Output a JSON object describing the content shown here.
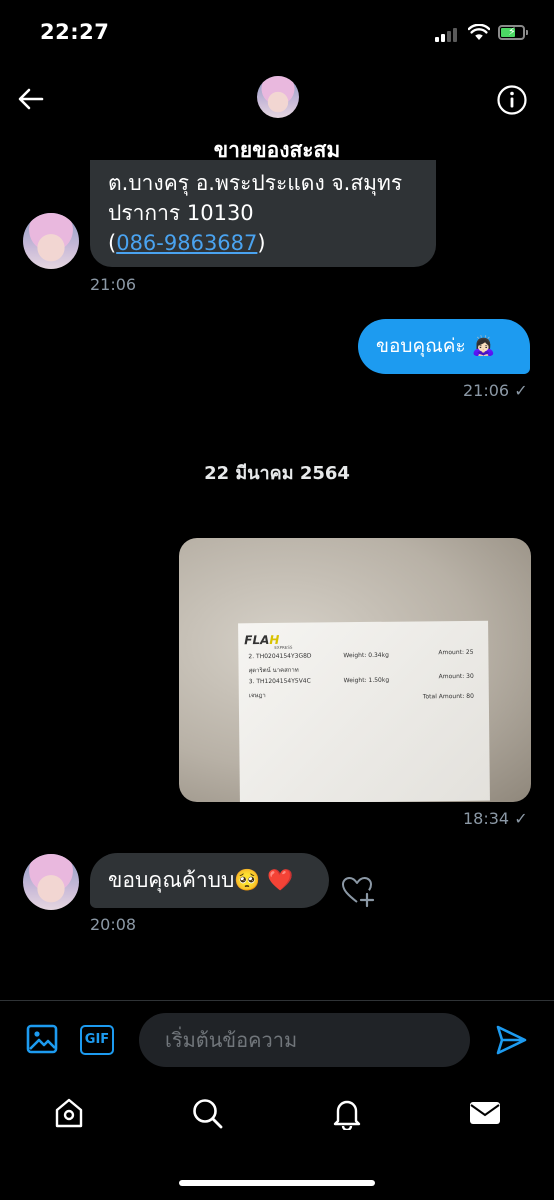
{
  "status_bar": {
    "time": "22:27",
    "battery_icon": "battery-charging-icon",
    "wifi_icon": "wifi-icon",
    "signal_icon": "cellular-signal-icon"
  },
  "header": {
    "title": "ขายของสะสม",
    "back_icon": "arrow-left-icon",
    "info_icon": "info-icon"
  },
  "messages": {
    "m1": {
      "line1": "ต.บางครุ อ.พระประแดง จ.สมุทร",
      "line2": "ปราการ 10130",
      "paren_open": "(",
      "phone": "086-9863687",
      "paren_close": ")",
      "time": "21:06"
    },
    "m2": {
      "text": "ขอบคุณค่ะ 🙇🏻‍♀️",
      "time": "21:06 ✓"
    },
    "date_separator": "22 มีนาคม 2564",
    "m3": {
      "time": "18:34 ✓",
      "photo": {
        "brand": "FLA",
        "brand_accent": "H",
        "brand_sub": "EXPRESS",
        "r1": "2. TH0204154Y3G8D",
        "r1b": "สุดาริตน์ นาคสกาท",
        "w1": "Weight: 0.34kg",
        "a1": "Amount: 25",
        "r2": "3. TH1204154Y5V4C",
        "r2b": "เจษฎา",
        "w2": "Weight: 1.50kg",
        "a2": "Amount: 30",
        "total": "Total Amount: 80"
      }
    },
    "m4": {
      "text": "ขอบคุณค้าบบ🥺 ❤️",
      "time": "20:08",
      "react_icon": "heart-add-icon"
    }
  },
  "composer": {
    "placeholder": "เริ่มต้นข้อความ",
    "gif_label": "GIF",
    "media_icon": "image-icon",
    "send_icon": "send-icon"
  },
  "nav": {
    "icons": [
      "home-icon",
      "search-icon",
      "bell-icon",
      "mail-icon"
    ]
  },
  "colors": {
    "accent": "#1d9bf0",
    "incoming_bubble": "#2f3336",
    "background": "#000000",
    "meta_text": "#8b98a5"
  }
}
